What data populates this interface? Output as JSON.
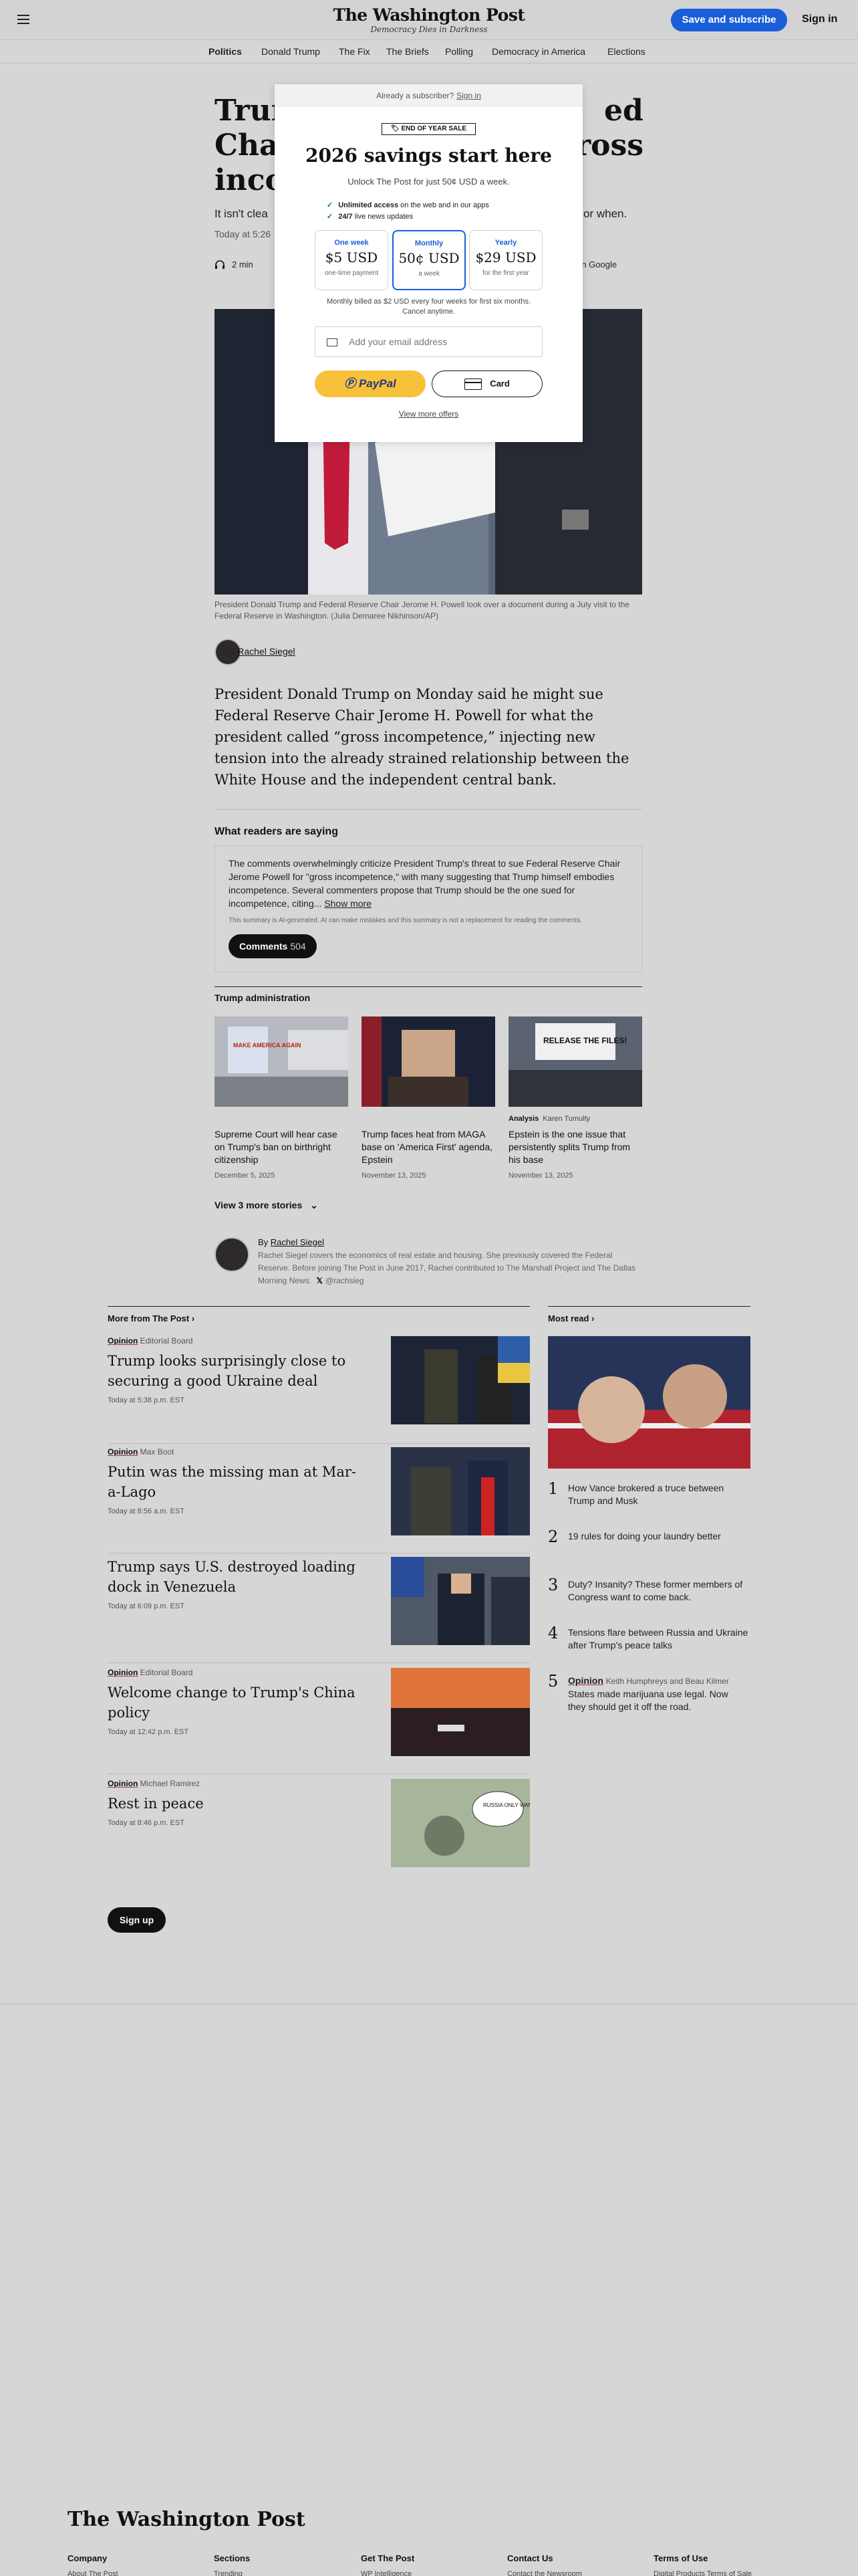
{
  "header": {
    "logo": "The Washington Post",
    "tagline": "Democracy Dies in Darkness",
    "subscribe_label": "Save and subscribe",
    "signin_label": "Sign in"
  },
  "subnav": [
    "Politics",
    "Donald Trump",
    "The Fix",
    "The Briefs",
    "Polling",
    "Democracy in America",
    "Elections"
  ],
  "article": {
    "headline_fragments": [
      "Trum",
      "ed",
      "Chai",
      "ross",
      "inco"
    ],
    "dek_left": "It isn't clea",
    "dek_right": "or when.",
    "timestamp": "Today at 5:26",
    "listen_time": "2 min",
    "google_label": "ed on Google",
    "caption": "President Donald Trump and Federal Reserve Chair Jerome H. Powell look over a document during a July visit to the Federal Reserve in Washington. (Julia Demaree Nikhinson/AP)",
    "byline_prefix": "By",
    "author": "Rachel Siegel",
    "body": "President Donald Trump on Monday said he might sue Federal Reserve Chair Jerome H. Powell for what the president called “gross incompetence,” injecting new tension into the already strained relationship between the White House and the independent central bank."
  },
  "readers": {
    "title": "What readers are saying",
    "summary": "The comments overwhelmingly criticize President Trump's threat to sue Federal Reserve Chair Jerome Powell for \"gross incompetence,\" with many suggesting that Trump himself embodies incompetence. Several commenters propose that Trump should be the one sued for incompetence, citing...",
    "show_more": "Show more",
    "disclaimer": "This summary is AI-generated. AI can make mistakes and this summary is not a replacement for reading the comments.",
    "comments_label": "Comments",
    "comments_count": "504"
  },
  "trump_admin": {
    "title": "Trump administration",
    "items": [
      {
        "label": "",
        "author": "",
        "title": "Supreme Court will hear case on Trump's ban on birthright citizenship",
        "date": "December 5, 2025"
      },
      {
        "label": "",
        "author": "",
        "title": "Trump faces heat from MAGA base on 'America First' agenda, Epstein",
        "date": "November 13, 2025"
      },
      {
        "label": "Analysis",
        "author": "Karen Tumulty",
        "title": "Epstein is the one issue that persistently splits Trump from his base",
        "date": "November 13, 2025"
      }
    ],
    "thumb_text_1": "MAKE AMERICA AGAIN",
    "thumb_text_3": "RELEASE THE FILES!",
    "view_more": "View 3 more stories"
  },
  "author_bio": {
    "prefix": "By",
    "name": "Rachel Siegel",
    "bio": "Rachel Siegel covers the economics of real estate and housing. She previously covered the Federal Reserve. Before joining The Post in June 2017, Rachel contributed to The Marshall Project and The Dallas Morning News.",
    "x_handle": "@rachsieg"
  },
  "more_from_post": {
    "title": "More from The Post",
    "items": [
      {
        "opinion": "Opinion",
        "byline": "Editorial Board",
        "title": "Trump looks surprisingly close to securing a good Ukraine deal",
        "time": "Today at 5:38 p.m. EST"
      },
      {
        "opinion": "Opinion",
        "byline": "Max Boot",
        "title": "Putin was the missing man at Mar-a-Lago",
        "time": "Today at 8:56 a.m. EST"
      },
      {
        "opinion": "",
        "byline": "",
        "title": "Trump says U.S. destroyed loading dock in Venezuela",
        "time": "Today at 6:09 p.m. EST"
      },
      {
        "opinion": "Opinion",
        "byline": "Editorial Board",
        "title": "Welcome change to Trump's China policy",
        "time": "Today at 12:42 p.m. EST"
      },
      {
        "opinion": "Opinion",
        "byline": "Michael Ramirez",
        "title": "Rest in peace",
        "time": "Today at 8:46 p.m. EST"
      }
    ],
    "cartoon_bubble": "RUSSIA ONLY WANTS PEACE"
  },
  "most_read": {
    "title": "Most read",
    "items": [
      {
        "num": "1",
        "opinion": "",
        "byline": "",
        "title": "How Vance brokered a truce between Trump and Musk"
      },
      {
        "num": "2",
        "opinion": "",
        "byline": "",
        "title": "19 rules for doing your laundry better"
      },
      {
        "num": "3",
        "opinion": "",
        "byline": "",
        "title": "Duty? Insanity? These former members of Congress want to come back."
      },
      {
        "num": "4",
        "opinion": "",
        "byline": "",
        "title": "Tensions flare between Russia and Ukraine after Trump's peace talks"
      },
      {
        "num": "5",
        "opinion": "Opinion",
        "byline": "Keith Humphreys and Beau Kilmer",
        "title": "States made marijuana use legal. Now they should get it off the road."
      }
    ]
  },
  "signup_label": "Sign up",
  "footer": {
    "logo": "The Washington Post",
    "columns": [
      {
        "title": "Company",
        "sub": "About The Post"
      },
      {
        "title": "Sections",
        "sub": "Trending"
      },
      {
        "title": "Get The Post",
        "sub": "WP Intelligence"
      },
      {
        "title": "Contact Us",
        "sub": "Contact the Newsroom"
      },
      {
        "title": "Terms of Use",
        "sub": "Digital Products Terms of Sale"
      }
    ]
  },
  "modal": {
    "already": "Already a subscriber?",
    "signin": "Sign in",
    "badge": "END OF YEAR SALE",
    "headline": "2026 savings start here",
    "subhead": "Unlock The Post for just 50¢ USD a week.",
    "benefits": [
      {
        "bold": "Unlimited access",
        "rest": "on the web and in our apps"
      },
      {
        "bold": "24/7",
        "rest": "live news updates"
      }
    ],
    "plans": [
      {
        "name": "One week",
        "price": "$5 USD",
        "note": "one-time payment"
      },
      {
        "name": "Monthly",
        "price": "50¢ USD",
        "note": "a week"
      },
      {
        "name": "Yearly",
        "price": "$29 USD",
        "note": "for the first year"
      }
    ],
    "billing_note": "Monthly billed as $2 USD every four weeks for first six months. Cancel anytime.",
    "email_placeholder": "Add your email address",
    "paypal": "PayPal",
    "card": "Card",
    "view_offers": "View more offers"
  },
  "colors": {
    "accent": "#1a5fd9",
    "paypal_yellow": "#f8c13a",
    "overlay_bg": "#d6d6d6"
  }
}
